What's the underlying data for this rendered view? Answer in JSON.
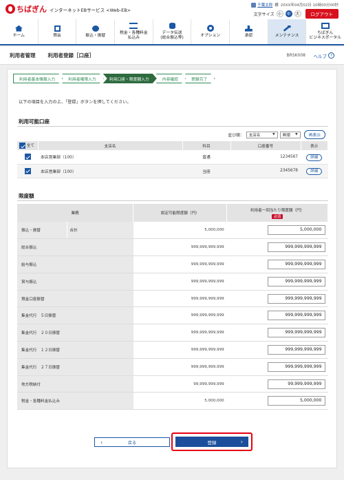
{
  "header": {
    "logo_text": "ちばぎん",
    "service_name": "インターネットEBサービス <Web-EB>",
    "user_name": "千葉太郎",
    "user_suffix": " 様",
    "last_login": "20XX年04月02日 10時00分00秒",
    "font_size_label": "文字サイズ",
    "font_sizes": [
      "小",
      "中",
      "大"
    ],
    "logout_label": "ログアウト"
  },
  "nav": [
    {
      "label": "ホーム",
      "icon": "home-icon"
    },
    {
      "label": "照会",
      "icon": "document-icon"
    },
    {
      "label": "振込・振替",
      "icon": "yen-icon"
    },
    {
      "label": "税金・各種料金\n払込み",
      "icon": "tax-icon"
    },
    {
      "label": "データ伝送\n(総合振込等)",
      "icon": "data-transfer-icon"
    },
    {
      "label": "オプション",
      "icon": "gear-icon"
    },
    {
      "label": "承認",
      "icon": "stamp-icon"
    },
    {
      "label": "メンテナンス",
      "icon": "wrench-icon",
      "active": true
    },
    {
      "label": "ちばぎん\nビジネスポータル",
      "icon": "monitor-icon"
    }
  ],
  "title": {
    "main": "利用者管理",
    "sub": "利用者登録［口座］",
    "code": "BRSK008",
    "help": "ヘルプ"
  },
  "steps": [
    "利用者基本情報入力",
    "利用者権限入力",
    "利用口座・限度額入力",
    "内容確認",
    "登録完了"
  ],
  "current_step": 2,
  "instruction": "以下の項目を入力の上、「登録」ボタンを押してください。",
  "accounts": {
    "section_title": "利用可能口座",
    "sort_label": "並び順：",
    "sort_field": "支店名",
    "sort_order": "昇順",
    "resort_label": "再表示",
    "headers": [
      "全て",
      "支店名",
      "科目",
      "口座番号",
      "表示"
    ],
    "rows": [
      {
        "branch": "本店営業部（100）",
        "type": "普通",
        "number": "1234567",
        "detail": "詳細"
      },
      {
        "branch": "本店営業部（100）",
        "type": "当座",
        "number": "2345678",
        "detail": "詳細"
      }
    ]
  },
  "limits": {
    "section_title": "限度額",
    "headers": [
      "業務",
      "設定可能限度額（円）",
      "利用者一回当たり限度額（円）"
    ],
    "required_label": "必須",
    "rows": [
      {
        "name": "振込・振替",
        "sub": "合計",
        "max": "5,000,000",
        "value": "5,000,000"
      },
      {
        "name": "総合振込",
        "max": "999,999,999,999",
        "value": "999,999,999,999"
      },
      {
        "name": "給与振込",
        "max": "999,999,999,999",
        "value": "999,999,999,999"
      },
      {
        "name": "賞与振込",
        "max": "999,999,999,999",
        "value": "999,999,999,999"
      },
      {
        "name": "預金口座振替",
        "max": "999,999,999,999",
        "value": "999,999,999,999"
      },
      {
        "name": "集金代行　５日振替",
        "max": "999,999,999,999",
        "value": "999,999,999,999"
      },
      {
        "name": "集金代行　２０日振替",
        "max": "999,999,999,999",
        "value": "999,999,999,999"
      },
      {
        "name": "集金代行　１２日振替",
        "max": "999,999,999,999",
        "value": "999,999,999,999"
      },
      {
        "name": "集金代行　２７日振替",
        "max": "999,999,999,999",
        "value": "999,999,999,999"
      },
      {
        "name": "地方税納付",
        "max": "99,999,999,999",
        "value": "99,999,999,999"
      },
      {
        "name": "税金・各種料金払込み",
        "max": "5,000,000",
        "value": "5,000,000"
      }
    ]
  },
  "buttons": {
    "back": "戻る",
    "submit": "登録"
  }
}
